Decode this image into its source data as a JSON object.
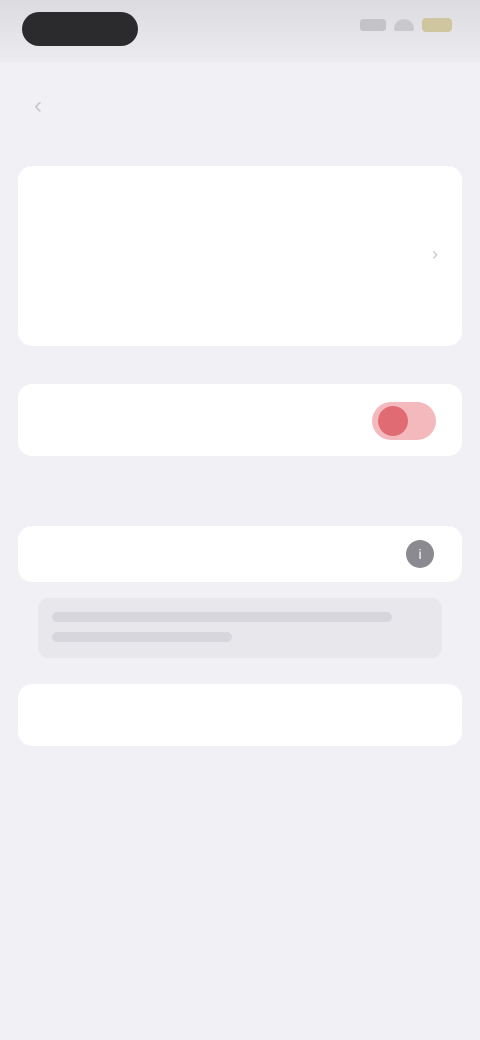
{
  "status_bar": {
    "time": "",
    "icons": [
      "signal-icon",
      "wifi-icon",
      "battery-icon"
    ]
  },
  "nav": {
    "back_icon": "chevron-left-icon",
    "title": "",
    "action": ""
  },
  "account_card": {
    "rows": [
      {
        "label": "",
        "value": ""
      },
      {
        "label": "",
        "value": ""
      },
      {
        "label": "",
        "value": ""
      }
    ],
    "chevron_icon": "chevron-right-icon"
  },
  "toggle_row": {
    "label": "",
    "enabled": true,
    "accent_color": "#e06b73"
  },
  "section": {
    "header": ""
  },
  "select_row": {
    "label": "",
    "icon": "info-icon"
  },
  "note": {
    "text": ""
  },
  "delete_action": {
    "label": "",
    "color": "#e06b73"
  },
  "footer": {
    "text": ""
  }
}
